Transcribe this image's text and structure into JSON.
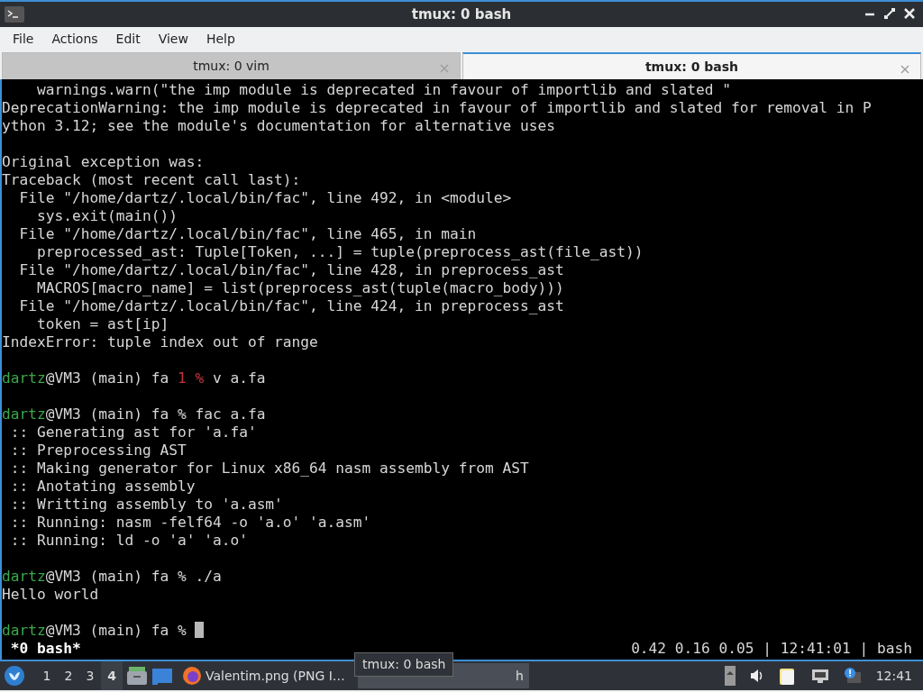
{
  "window": {
    "title": "tmux: 0 bash"
  },
  "menu": [
    "File",
    "Actions",
    "Edit",
    "View",
    "Help"
  ],
  "tabs": [
    {
      "label": "tmux: 0 vim",
      "selected": false
    },
    {
      "label": "tmux: 0 bash",
      "selected": true
    }
  ],
  "terminal": {
    "lines": [
      {
        "kind": "text",
        "segments": [
          {
            "kind": "plain",
            "text": "    warnings.warn(\"the imp module is deprecated in favour of importlib and slated \""
          }
        ]
      },
      {
        "kind": "text",
        "segments": [
          {
            "kind": "plain",
            "text": "DeprecationWarning: the imp module is deprecated in favour of importlib and slated for removal in P"
          }
        ]
      },
      {
        "kind": "text",
        "segments": [
          {
            "kind": "plain",
            "text": "ython 3.12; see the module's documentation for alternative uses"
          }
        ]
      },
      {
        "kind": "blank"
      },
      {
        "kind": "text",
        "segments": [
          {
            "kind": "plain",
            "text": "Original exception was:"
          }
        ]
      },
      {
        "kind": "text",
        "segments": [
          {
            "kind": "plain",
            "text": "Traceback (most recent call last):"
          }
        ]
      },
      {
        "kind": "text",
        "segments": [
          {
            "kind": "plain",
            "text": "  File \"/home/dartz/.local/bin/fac\", line 492, in <module>"
          }
        ]
      },
      {
        "kind": "text",
        "segments": [
          {
            "kind": "plain",
            "text": "    sys.exit(main())"
          }
        ]
      },
      {
        "kind": "text",
        "segments": [
          {
            "kind": "plain",
            "text": "  File \"/home/dartz/.local/bin/fac\", line 465, in main"
          }
        ]
      },
      {
        "kind": "text",
        "segments": [
          {
            "kind": "plain",
            "text": "    preprocessed_ast: Tuple[Token, ...] = tuple(preprocess_ast(file_ast))"
          }
        ]
      },
      {
        "kind": "text",
        "segments": [
          {
            "kind": "plain",
            "text": "  File \"/home/dartz/.local/bin/fac\", line 428, in preprocess_ast"
          }
        ]
      },
      {
        "kind": "text",
        "segments": [
          {
            "kind": "plain",
            "text": "    MACROS[macro_name] = list(preprocess_ast(tuple(macro_body)))"
          }
        ]
      },
      {
        "kind": "text",
        "segments": [
          {
            "kind": "plain",
            "text": "  File \"/home/dartz/.local/bin/fac\", line 424, in preprocess_ast"
          }
        ]
      },
      {
        "kind": "text",
        "segments": [
          {
            "kind": "plain",
            "text": "    token = ast[ip]"
          }
        ]
      },
      {
        "kind": "text",
        "segments": [
          {
            "kind": "plain",
            "text": "IndexError: tuple index out of range"
          }
        ]
      },
      {
        "kind": "blank"
      },
      {
        "kind": "text",
        "segments": [
          {
            "kind": "user",
            "text": "dartz"
          },
          {
            "kind": "plain",
            "text": "@VM3 (main) fa "
          },
          {
            "kind": "error",
            "text": "1 %"
          },
          {
            "kind": "plain",
            "text": " v a.fa"
          }
        ]
      },
      {
        "kind": "blank"
      },
      {
        "kind": "text",
        "segments": [
          {
            "kind": "user",
            "text": "dartz"
          },
          {
            "kind": "plain",
            "text": "@VM3 (main) fa % fac a.fa"
          }
        ]
      },
      {
        "kind": "text",
        "segments": [
          {
            "kind": "plain",
            "text": " :: Generating ast for 'a.fa'"
          }
        ]
      },
      {
        "kind": "text",
        "segments": [
          {
            "kind": "plain",
            "text": " :: Preprocessing AST"
          }
        ]
      },
      {
        "kind": "text",
        "segments": [
          {
            "kind": "plain",
            "text": " :: Making generator for Linux x86_64 nasm assembly from AST"
          }
        ]
      },
      {
        "kind": "text",
        "segments": [
          {
            "kind": "plain",
            "text": " :: Anotating assembly"
          }
        ]
      },
      {
        "kind": "text",
        "segments": [
          {
            "kind": "plain",
            "text": " :: Writting assembly to 'a.asm'"
          }
        ]
      },
      {
        "kind": "text",
        "segments": [
          {
            "kind": "plain",
            "text": " :: Running: nasm -felf64 -o 'a.o' 'a.asm'"
          }
        ]
      },
      {
        "kind": "text",
        "segments": [
          {
            "kind": "plain",
            "text": " :: Running: ld -o 'a' 'a.o'"
          }
        ]
      },
      {
        "kind": "blank"
      },
      {
        "kind": "text",
        "segments": [
          {
            "kind": "user",
            "text": "dartz"
          },
          {
            "kind": "plain",
            "text": "@VM3 (main) fa % ./a"
          }
        ]
      },
      {
        "kind": "text",
        "segments": [
          {
            "kind": "plain",
            "text": "Hello world"
          }
        ]
      },
      {
        "kind": "blank"
      },
      {
        "kind": "text",
        "cursor": true,
        "segments": [
          {
            "kind": "user",
            "text": "dartz"
          },
          {
            "kind": "plain",
            "text": "@VM3 (main) fa % "
          }
        ]
      }
    ],
    "status_bar": {
      "window": " *0 bash*",
      "right": "0.42 0.16 0.05 | 12:41:01 | bash"
    }
  },
  "taskbar": {
    "workspaces": [
      {
        "label": "1",
        "selected": false
      },
      {
        "label": "2",
        "selected": false
      },
      {
        "label": "3",
        "selected": false
      },
      {
        "label": "4",
        "selected": true
      }
    ],
    "tasks": [
      {
        "kind": "browser",
        "label": "Valentim.png (PNG I…"
      },
      {
        "kind": "terminal",
        "label": "h"
      }
    ],
    "tooltip": "tmux: 0 bash",
    "clock": "12:41"
  }
}
